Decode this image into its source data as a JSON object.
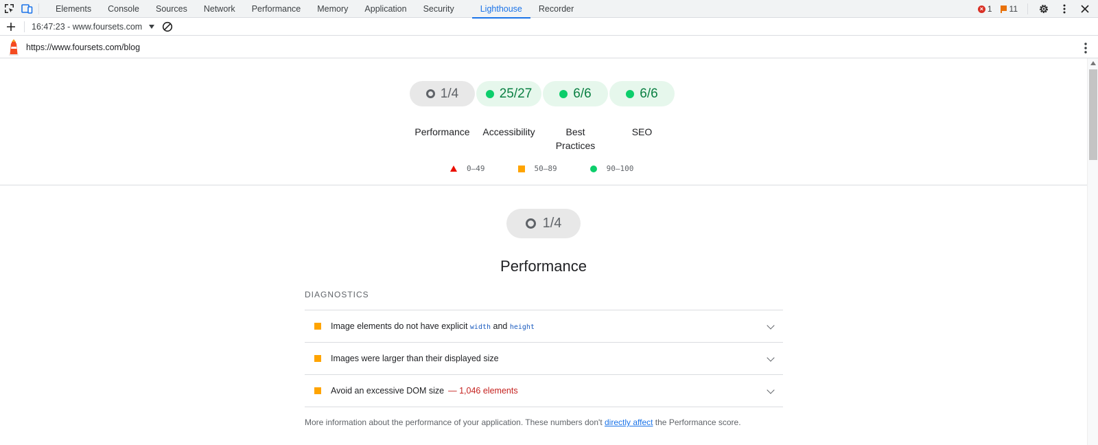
{
  "devtools": {
    "tabs": [
      {
        "label": "Elements"
      },
      {
        "label": "Console"
      },
      {
        "label": "Sources"
      },
      {
        "label": "Network"
      },
      {
        "label": "Performance"
      },
      {
        "label": "Memory"
      },
      {
        "label": "Application"
      },
      {
        "label": "Security"
      },
      {
        "label": "Lighthouse"
      },
      {
        "label": "Recorder"
      }
    ],
    "active_tab": "Lighthouse",
    "error_count": "1",
    "warning_count": "11"
  },
  "report_bar": {
    "report_label": "16:47:23 - www.foursets.com"
  },
  "url_bar": {
    "url": "https://www.foursets.com/blog"
  },
  "scores": [
    {
      "score": "1/4",
      "label": "Performance",
      "status": "neutral"
    },
    {
      "score": "25/27",
      "label": "Accessibility",
      "status": "pass"
    },
    {
      "score": "6/6",
      "label": "Best Practices",
      "status": "pass"
    },
    {
      "score": "6/6",
      "label": "SEO",
      "status": "pass"
    }
  ],
  "legend": {
    "fail": "0–49",
    "average": "50–89",
    "pass": "90–100"
  },
  "section": {
    "score": "1/4",
    "title": "Performance",
    "diagnostics_heading": "DIAGNOSTICS",
    "audits": [
      {
        "prefix": "Image elements do not have explicit ",
        "code1": "width",
        "mid": " and ",
        "code2": "height"
      },
      {
        "title": "Images were larger than their displayed size"
      },
      {
        "title": "Avoid an excessive DOM size",
        "display_value": "— 1,046 elements"
      }
    ],
    "description": {
      "before": "More information about the performance of your application. These numbers don't ",
      "link": "directly affect",
      "after": " the Performance score."
    }
  },
  "colors": {
    "accent": "#1a73e8",
    "pass": "#0cce6b",
    "average": "#ffa400",
    "fail": "#eb0f00"
  }
}
